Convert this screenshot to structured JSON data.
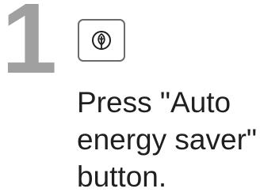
{
  "step": {
    "number": "1",
    "icon": "leaf-icon",
    "instruction": "Press \"Auto\nenergy saver\"\nbutton."
  },
  "colors": {
    "step_number": "#a0a0a0",
    "text": "#1f1f1f",
    "button_border": "#6b6b6b"
  }
}
